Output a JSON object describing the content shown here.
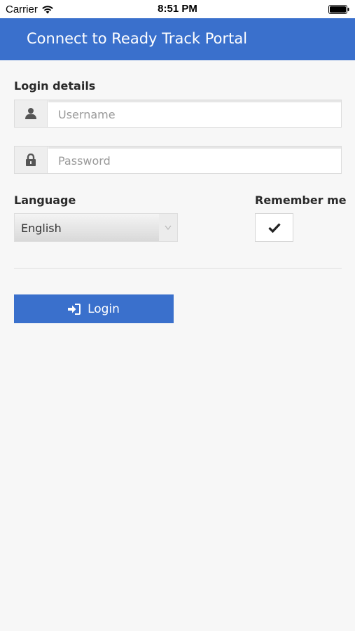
{
  "status_bar": {
    "carrier": "Carrier",
    "time": "8:51 PM"
  },
  "header": {
    "title": "Connect to Ready Track Portal"
  },
  "form": {
    "login_details_label": "Login details",
    "username": {
      "value": "",
      "placeholder": "Username",
      "icon": "user-icon"
    },
    "password": {
      "value": "",
      "placeholder": "Password",
      "icon": "lock-icon"
    },
    "language_label": "Language",
    "language_selected": "English",
    "remember_label": "Remember me",
    "remember_checked": true,
    "login_label": "Login"
  },
  "colors": {
    "accent": "#3a70cc",
    "background": "#f7f7f7"
  }
}
